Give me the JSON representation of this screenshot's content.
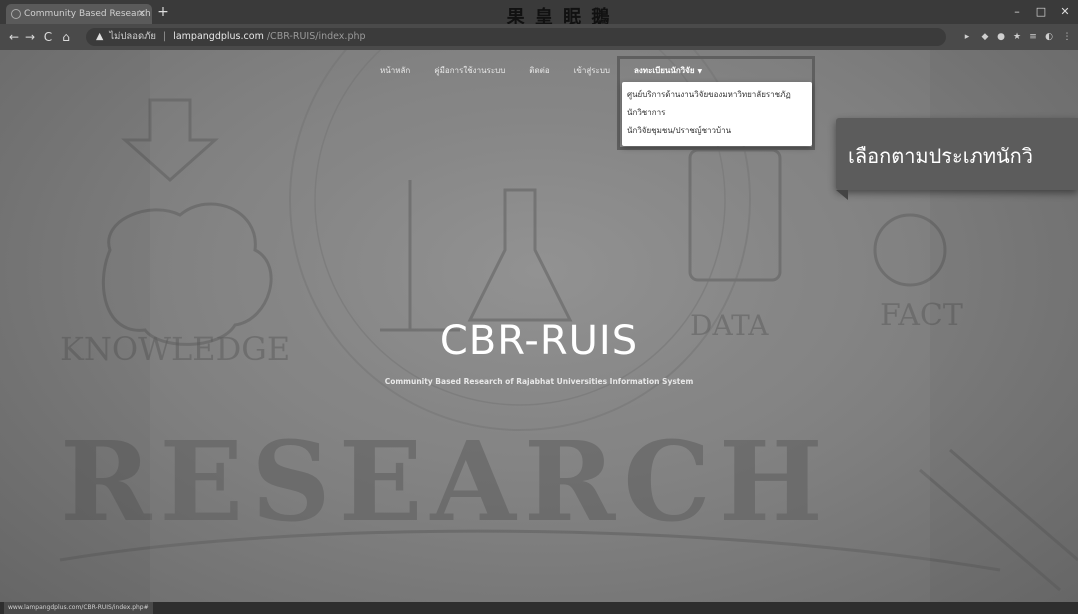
{
  "browser": {
    "tab_title": "Community Based Research",
    "newtab_label": "+",
    "tab_close": "×",
    "window_controls": [
      "–",
      "□",
      "✕"
    ],
    "nav": {
      "back": "←",
      "forward": "→",
      "reload": "C",
      "home": "⌂"
    },
    "address": {
      "security": "ไม่ปลอดภัย",
      "host": "lampangdplus.com",
      "path": "/CBR-RUIS/index.php"
    },
    "status_url": "www.lampangdplus.com/CBR-RUIS/index.php#"
  },
  "watermark": {
    "header_brand": "果 皇 眠 鵝"
  },
  "site": {
    "menu": [
      {
        "label": "หน้าหลัก",
        "active": false
      },
      {
        "label": "คู่มือการใช้งานระบบ",
        "active": false
      },
      {
        "label": "ติดต่อ",
        "active": false
      },
      {
        "label": "เข้าสู่ระบบ",
        "active": false
      },
      {
        "label": "ลงทะเบียนนักวิจัย",
        "active": true
      }
    ],
    "dropdown": [
      "ศูนย์บริการด้านงานวิจัยของมหาวิทยาลัยราชภัฏ",
      "นักวิชาการ",
      "นักวิจัยชุมชน/ปราชญ์ชาวบ้าน"
    ],
    "callout_text": "เลือกตามประเภทนักวิ",
    "hero_title": "CBR-RUIS",
    "hero_subtitle": "Community Based Research of Rajabhat Universities Information System",
    "background_words": [
      "KNOWLEDGE",
      "DATA",
      "FACT",
      "RESEARCH"
    ]
  },
  "colors": {
    "page_bg": "#7a7a7a",
    "callout_bg": "#5c5c5c",
    "dropdown_bg": "#ffffff"
  }
}
